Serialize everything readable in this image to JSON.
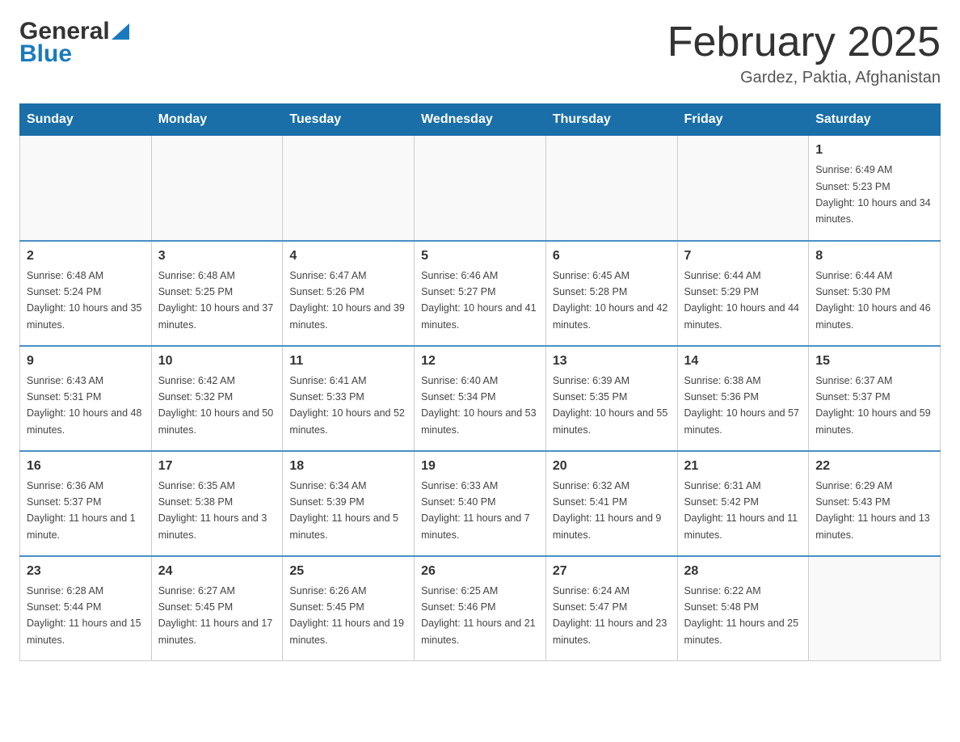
{
  "header": {
    "logo_general": "General",
    "logo_blue": "Blue",
    "month_title": "February 2025",
    "location": "Gardez, Paktia, Afghanistan"
  },
  "days_of_week": [
    "Sunday",
    "Monday",
    "Tuesday",
    "Wednesday",
    "Thursday",
    "Friday",
    "Saturday"
  ],
  "weeks": [
    [
      {
        "day": "",
        "info": ""
      },
      {
        "day": "",
        "info": ""
      },
      {
        "day": "",
        "info": ""
      },
      {
        "day": "",
        "info": ""
      },
      {
        "day": "",
        "info": ""
      },
      {
        "day": "",
        "info": ""
      },
      {
        "day": "1",
        "info": "Sunrise: 6:49 AM\nSunset: 5:23 PM\nDaylight: 10 hours and 34 minutes."
      }
    ],
    [
      {
        "day": "2",
        "info": "Sunrise: 6:48 AM\nSunset: 5:24 PM\nDaylight: 10 hours and 35 minutes."
      },
      {
        "day": "3",
        "info": "Sunrise: 6:48 AM\nSunset: 5:25 PM\nDaylight: 10 hours and 37 minutes."
      },
      {
        "day": "4",
        "info": "Sunrise: 6:47 AM\nSunset: 5:26 PM\nDaylight: 10 hours and 39 minutes."
      },
      {
        "day": "5",
        "info": "Sunrise: 6:46 AM\nSunset: 5:27 PM\nDaylight: 10 hours and 41 minutes."
      },
      {
        "day": "6",
        "info": "Sunrise: 6:45 AM\nSunset: 5:28 PM\nDaylight: 10 hours and 42 minutes."
      },
      {
        "day": "7",
        "info": "Sunrise: 6:44 AM\nSunset: 5:29 PM\nDaylight: 10 hours and 44 minutes."
      },
      {
        "day": "8",
        "info": "Sunrise: 6:44 AM\nSunset: 5:30 PM\nDaylight: 10 hours and 46 minutes."
      }
    ],
    [
      {
        "day": "9",
        "info": "Sunrise: 6:43 AM\nSunset: 5:31 PM\nDaylight: 10 hours and 48 minutes."
      },
      {
        "day": "10",
        "info": "Sunrise: 6:42 AM\nSunset: 5:32 PM\nDaylight: 10 hours and 50 minutes."
      },
      {
        "day": "11",
        "info": "Sunrise: 6:41 AM\nSunset: 5:33 PM\nDaylight: 10 hours and 52 minutes."
      },
      {
        "day": "12",
        "info": "Sunrise: 6:40 AM\nSunset: 5:34 PM\nDaylight: 10 hours and 53 minutes."
      },
      {
        "day": "13",
        "info": "Sunrise: 6:39 AM\nSunset: 5:35 PM\nDaylight: 10 hours and 55 minutes."
      },
      {
        "day": "14",
        "info": "Sunrise: 6:38 AM\nSunset: 5:36 PM\nDaylight: 10 hours and 57 minutes."
      },
      {
        "day": "15",
        "info": "Sunrise: 6:37 AM\nSunset: 5:37 PM\nDaylight: 10 hours and 59 minutes."
      }
    ],
    [
      {
        "day": "16",
        "info": "Sunrise: 6:36 AM\nSunset: 5:37 PM\nDaylight: 11 hours and 1 minute."
      },
      {
        "day": "17",
        "info": "Sunrise: 6:35 AM\nSunset: 5:38 PM\nDaylight: 11 hours and 3 minutes."
      },
      {
        "day": "18",
        "info": "Sunrise: 6:34 AM\nSunset: 5:39 PM\nDaylight: 11 hours and 5 minutes."
      },
      {
        "day": "19",
        "info": "Sunrise: 6:33 AM\nSunset: 5:40 PM\nDaylight: 11 hours and 7 minutes."
      },
      {
        "day": "20",
        "info": "Sunrise: 6:32 AM\nSunset: 5:41 PM\nDaylight: 11 hours and 9 minutes."
      },
      {
        "day": "21",
        "info": "Sunrise: 6:31 AM\nSunset: 5:42 PM\nDaylight: 11 hours and 11 minutes."
      },
      {
        "day": "22",
        "info": "Sunrise: 6:29 AM\nSunset: 5:43 PM\nDaylight: 11 hours and 13 minutes."
      }
    ],
    [
      {
        "day": "23",
        "info": "Sunrise: 6:28 AM\nSunset: 5:44 PM\nDaylight: 11 hours and 15 minutes."
      },
      {
        "day": "24",
        "info": "Sunrise: 6:27 AM\nSunset: 5:45 PM\nDaylight: 11 hours and 17 minutes."
      },
      {
        "day": "25",
        "info": "Sunrise: 6:26 AM\nSunset: 5:45 PM\nDaylight: 11 hours and 19 minutes."
      },
      {
        "day": "26",
        "info": "Sunrise: 6:25 AM\nSunset: 5:46 PM\nDaylight: 11 hours and 21 minutes."
      },
      {
        "day": "27",
        "info": "Sunrise: 6:24 AM\nSunset: 5:47 PM\nDaylight: 11 hours and 23 minutes."
      },
      {
        "day": "28",
        "info": "Sunrise: 6:22 AM\nSunset: 5:48 PM\nDaylight: 11 hours and 25 minutes."
      },
      {
        "day": "",
        "info": ""
      }
    ]
  ]
}
